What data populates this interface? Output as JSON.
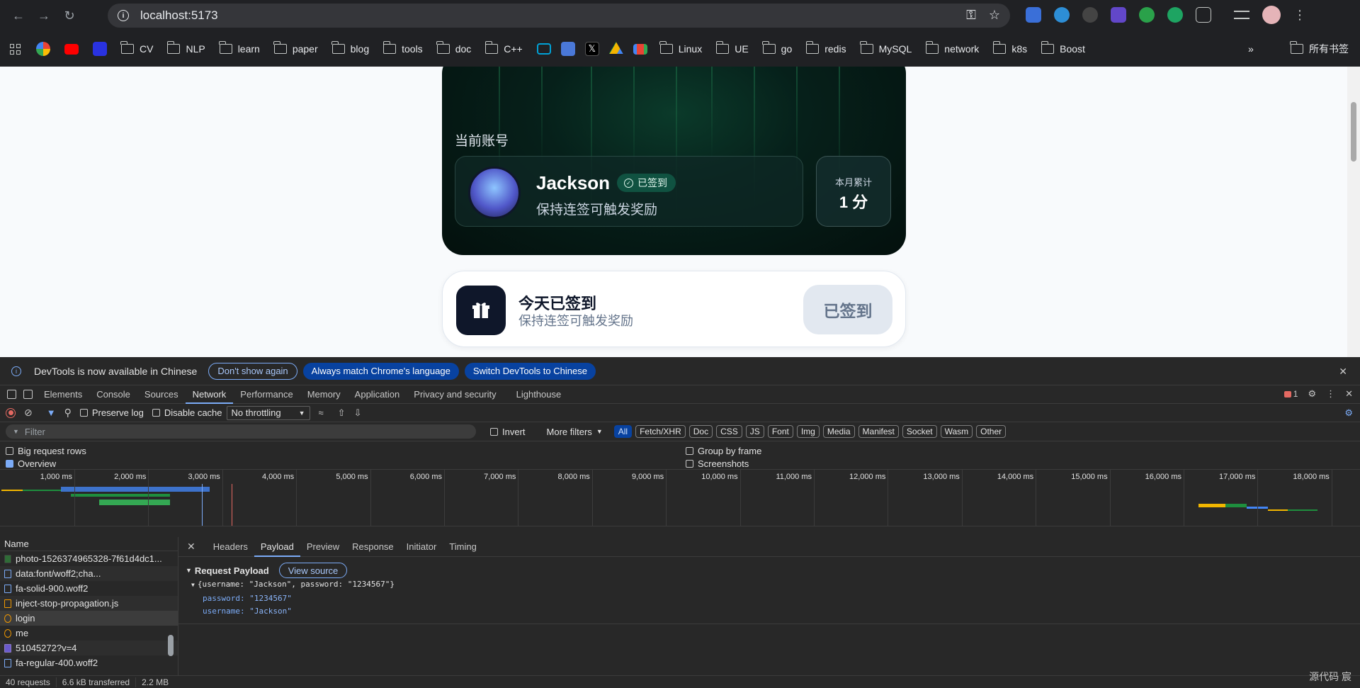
{
  "browser": {
    "url": "localhost:5173",
    "bookmarks": [
      "CV",
      "NLP",
      "learn",
      "paper",
      "blog",
      "tools",
      "doc",
      "C++",
      "Linux",
      "UE",
      "go",
      "redis",
      "MySQL",
      "network",
      "k8s",
      "Boost"
    ],
    "all_bookmarks": "所有书签"
  },
  "hero": {
    "label": "当前账号",
    "username": "Jackson",
    "badge": "已签到",
    "subtitle": "保持连签可触发奖励",
    "points_label": "本月累计",
    "points_value": "1 分"
  },
  "checkin": {
    "title": "今天已签到",
    "subtitle": "保持连签可触发奖励",
    "button": "已签到"
  },
  "devtools": {
    "info_message": "DevTools is now available in Chinese",
    "dont_show": "Don't show again",
    "match_language": "Always match Chrome's language",
    "switch_chinese": "Switch DevTools to Chinese",
    "tabs": [
      "Elements",
      "Console",
      "Sources",
      "Network",
      "Performance",
      "Memory",
      "Application",
      "Privacy and security",
      "Lighthouse"
    ],
    "error_count": "1",
    "preserve_log": "Preserve log",
    "disable_cache": "Disable cache",
    "throttling": "No throttling",
    "filter_placeholder": "Filter",
    "invert": "Invert",
    "more_filters": "More filters",
    "filter_types": [
      "All",
      "Fetch/XHR",
      "Doc",
      "CSS",
      "JS",
      "Font",
      "Img",
      "Media",
      "Manifest",
      "Socket",
      "Wasm",
      "Other"
    ],
    "big_request_rows": "Big request rows",
    "overview": "Overview",
    "group_by_frame": "Group by frame",
    "screenshots": "Screenshots",
    "timeline_ticks": [
      "1,000 ms",
      "2,000 ms",
      "3,000 ms",
      "4,000 ms",
      "5,000 ms",
      "6,000 ms",
      "7,000 ms",
      "8,000 ms",
      "9,000 ms",
      "10,000 ms",
      "11,000 ms",
      "12,000 ms",
      "13,000 ms",
      "14,000 ms",
      "15,000 ms",
      "16,000 ms",
      "17,000 ms",
      "18,000 ms"
    ],
    "name_header": "Name",
    "requests": [
      {
        "name": "photo-1526374965328-7f61d4dc1...",
        "type": "img"
      },
      {
        "name": "data:font/woff2;cha...",
        "type": "font"
      },
      {
        "name": "fa-solid-900.woff2",
        "type": "font"
      },
      {
        "name": "inject-stop-propagation.js",
        "type": "js"
      },
      {
        "name": "login",
        "type": "xhr"
      },
      {
        "name": "me",
        "type": "xhr"
      },
      {
        "name": "51045272?v=4",
        "type": "svg"
      },
      {
        "name": "fa-regular-400.woff2",
        "type": "font"
      }
    ],
    "detail_tabs": [
      "Headers",
      "Payload",
      "Preview",
      "Response",
      "Initiator",
      "Timing"
    ],
    "request_payload": "Request Payload",
    "view_source": "View source",
    "payload_summary": "{username: \"Jackson\", password: \"1234567\"}",
    "payload_password_key": "password:",
    "payload_password_val": "\"1234567\"",
    "payload_username_key": "username:",
    "payload_username_val": "\"Jackson\"",
    "status_requests": "40 requests",
    "status_transferred": "6.6 kB transferred",
    "status_resources": "2.2 MB",
    "bottom_right": "源代码  宸"
  },
  "colors": {
    "accent": "#7cacf8",
    "hero_bg": "#06201a",
    "checkin_btn_bg": "#e2e8f0"
  }
}
